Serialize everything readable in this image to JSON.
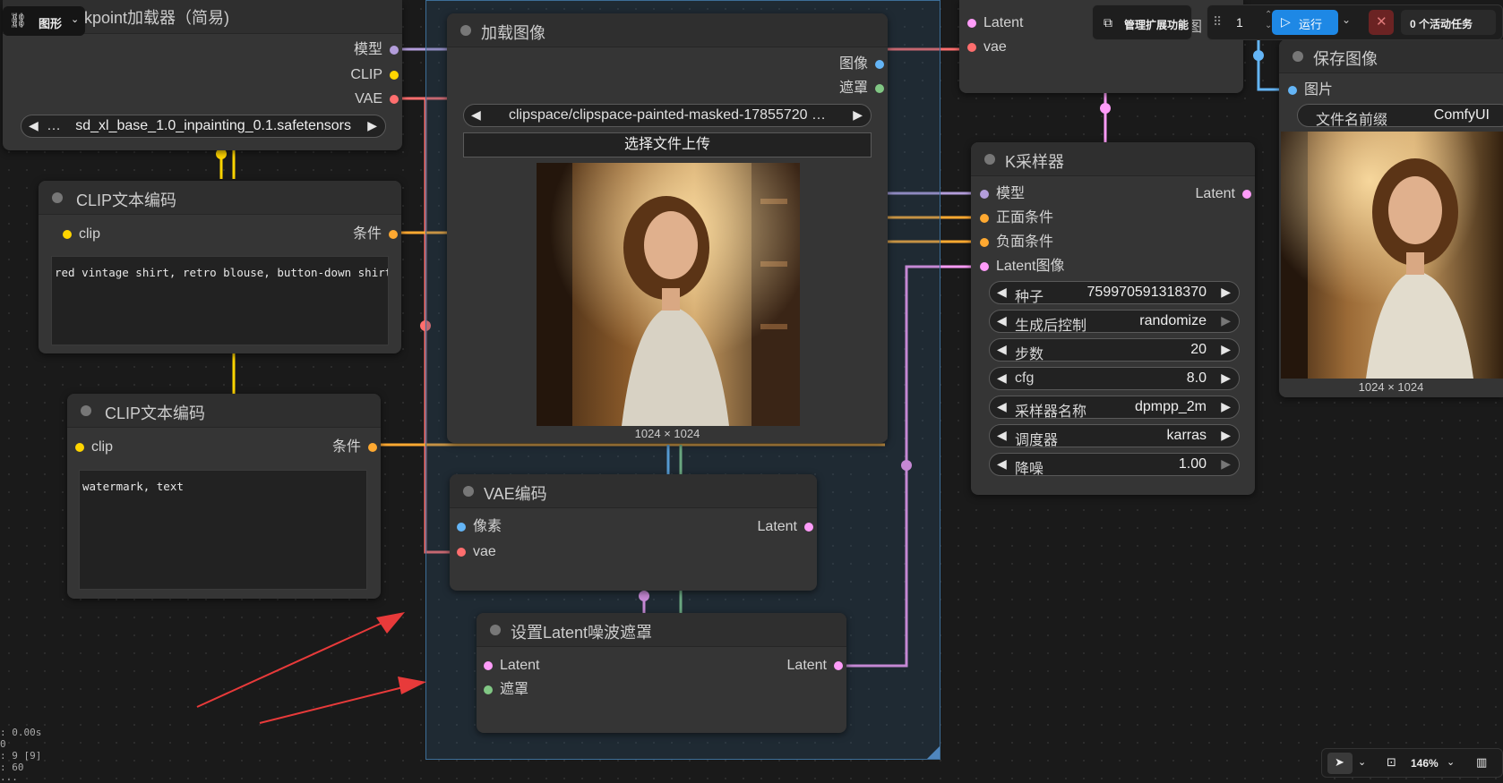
{
  "toolbar": {
    "graph_menu_label": "图形",
    "manage_extensions_label": "管理扩展功能",
    "queue_count": "1",
    "run_label": "运行",
    "active_tasks_label": "0 个活动任务"
  },
  "nodes": {
    "checkpoint": {
      "title": "kpoint加载器（简易)",
      "outputs": [
        "模型",
        "CLIP",
        "VAE"
      ],
      "ckpt_prefix": "…",
      "ckpt_name": "sd_xl_base_1.0_inpainting_0.1.safetensors"
    },
    "clip_pos": {
      "title": "CLIP文本编码",
      "input": "clip",
      "output": "条件",
      "text": "red vintage shirt, retro blouse, button-down shirt"
    },
    "clip_neg": {
      "title": "CLIP文本编码",
      "input": "clip",
      "output": "条件",
      "text": "watermark, text"
    },
    "load_image": {
      "title": "加载图像",
      "outputs": [
        "图像",
        "遮罩"
      ],
      "image_name": "clipspace/clipspace-painted-masked-17855720 …",
      "upload_label": "选择文件上传",
      "size": "1024 × 1024"
    },
    "vae_encode": {
      "title": "VAE编码",
      "inputs": [
        "像素",
        "vae"
      ],
      "output": "Latent"
    },
    "set_mask": {
      "title": "设置Latent噪波遮罩",
      "inputs": [
        "Latent",
        "遮罩"
      ],
      "output": "Latent"
    },
    "vae_decode": {
      "inputs": [
        "Latent",
        "vae"
      ],
      "partial_title": "图"
    },
    "ksampler": {
      "title": "K采样器",
      "inputs": [
        "模型",
        "正面条件",
        "负面条件",
        "Latent图像"
      ],
      "output": "Latent",
      "widgets": [
        {
          "label": "种子",
          "value": "759970591318370"
        },
        {
          "label": "生成后控制",
          "value": "randomize"
        },
        {
          "label": "步数",
          "value": "20"
        },
        {
          "label": "cfg",
          "value": "8.0"
        },
        {
          "label": "采样器名称",
          "value": "dpmpp_2m"
        },
        {
          "label": "调度器",
          "value": "karras"
        },
        {
          "label": "降噪",
          "value": "1.00"
        }
      ]
    },
    "save_image": {
      "title": "保存图像",
      "input": "图片",
      "prefix_label": "文件名前缀",
      "prefix_value": "ComfyUI",
      "size": "1024 × 1024"
    }
  },
  "status": {
    "zoom": "146%",
    "debug_lines": [
      ": 0.00s",
      "0",
      ": 9 [9]",
      ": 60",
      "..."
    ]
  },
  "colors": {
    "model": "#b39ddb",
    "clip": "#ffd500",
    "vae": "#ff6e6e",
    "conditioning": "#ffa931",
    "latent": "#ff9cf9",
    "image": "#64b5f6",
    "mask": "#81c784",
    "annotation": "#e83a3a",
    "run_button": "#1e88e5"
  }
}
